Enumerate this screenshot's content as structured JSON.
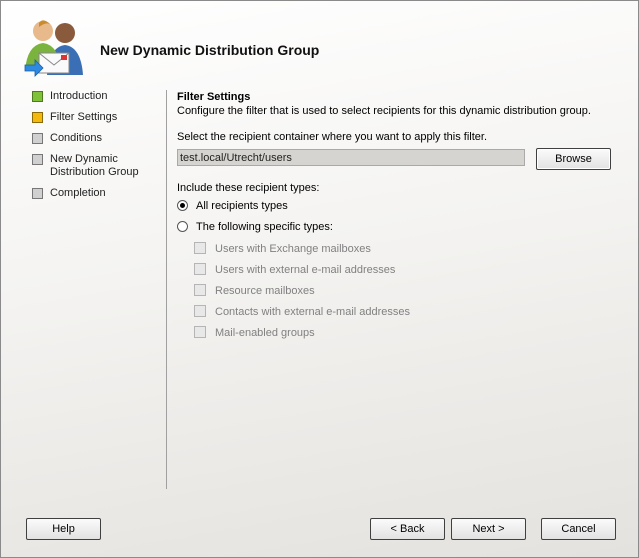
{
  "wizard": {
    "title": "New Dynamic Distribution Group"
  },
  "nav": {
    "items": [
      {
        "label": "Introduction",
        "state": "done"
      },
      {
        "label": "Filter Settings",
        "state": "current"
      },
      {
        "label": "Conditions",
        "state": "pending"
      },
      {
        "label": "New Dynamic Distribution Group",
        "state": "pending"
      },
      {
        "label": "Completion",
        "state": "pending"
      }
    ]
  },
  "filter": {
    "title": "Filter Settings",
    "description": "Configure the filter that is used to select recipients for this dynamic distribution group.",
    "container_label": "Select the recipient container where you want to apply this filter.",
    "container_value": "test.local/Utrecht/users",
    "browse_label": "Browse",
    "types_label": "Include these recipient types:",
    "radio_all": "All recipients types",
    "radio_specific": "The following specific types:",
    "radio_selected": "all",
    "checkboxes": [
      "Users with Exchange mailboxes",
      "Users with external e-mail addresses",
      "Resource mailboxes",
      "Contacts with external e-mail addresses",
      "Mail-enabled groups"
    ]
  },
  "buttons": {
    "help": "Help",
    "back": "< Back",
    "next": "Next >",
    "cancel": "Cancel"
  },
  "colors": {
    "done": "#7fc23a",
    "current": "#f2b90c",
    "pending": "#d0d0d0"
  }
}
